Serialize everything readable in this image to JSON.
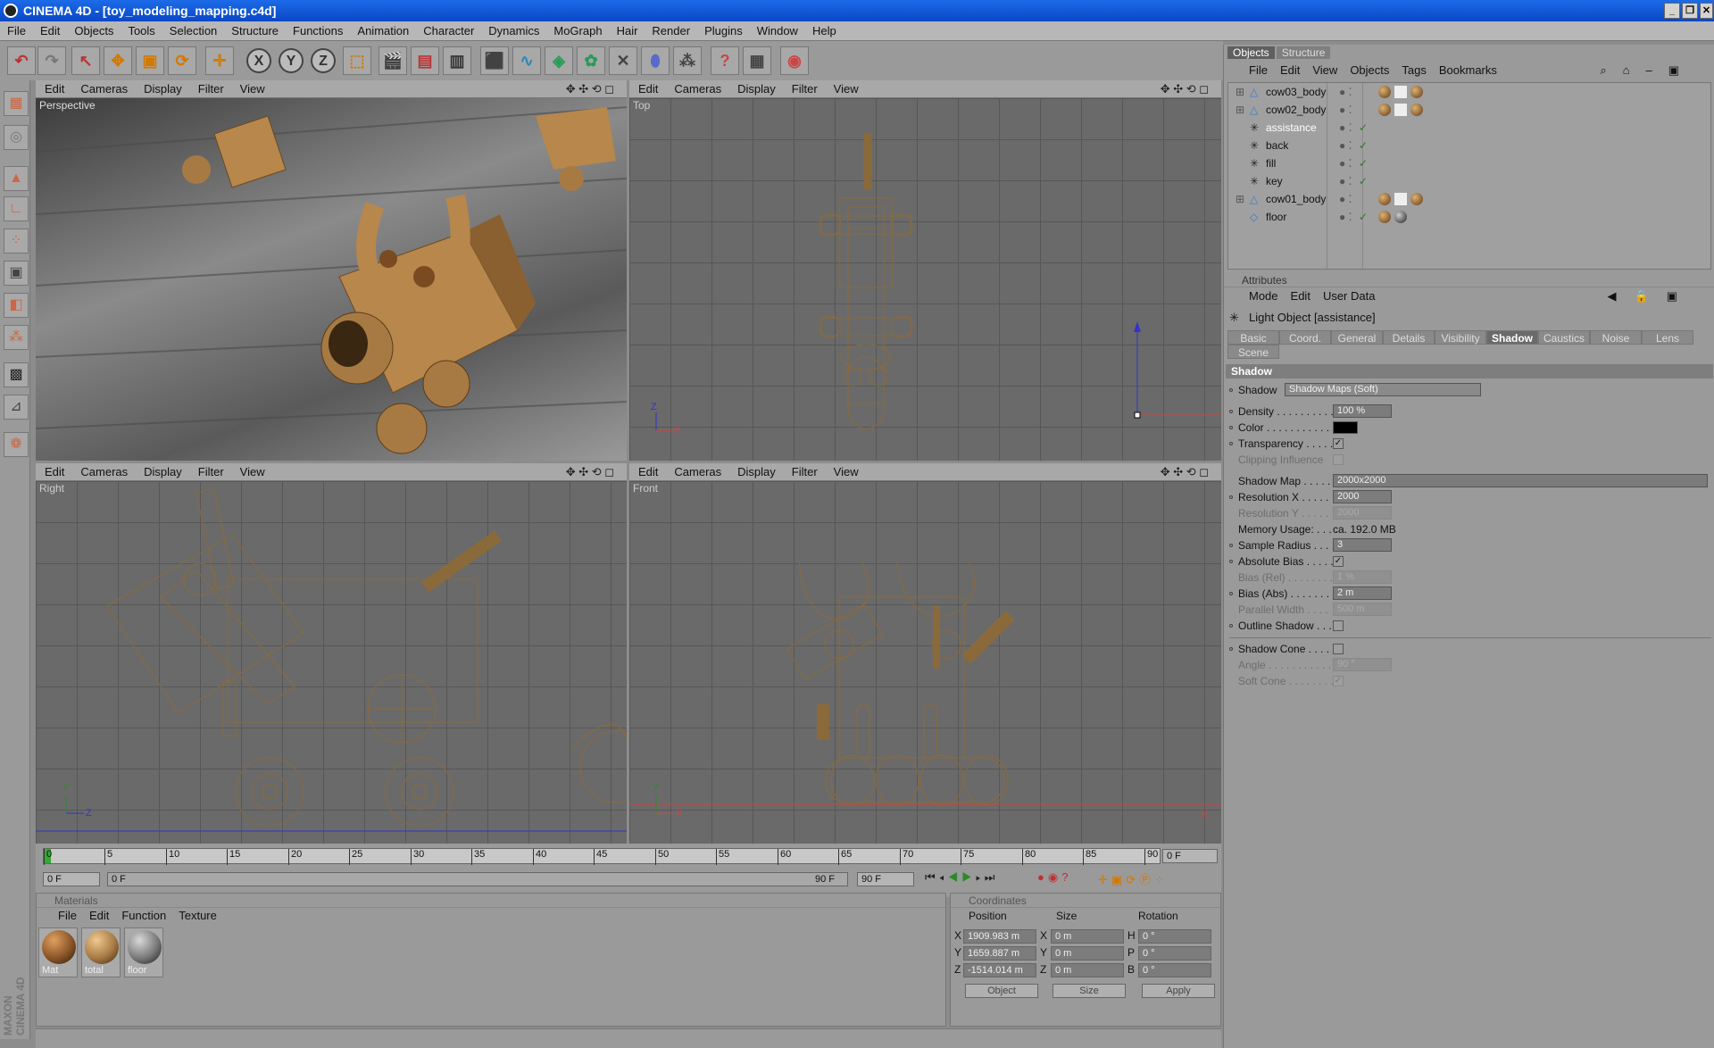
{
  "window": {
    "title": "CINEMA 4D - [toy_modeling_mapping.c4d]"
  },
  "menubar": [
    "File",
    "Edit",
    "Objects",
    "Tools",
    "Selection",
    "Structure",
    "Functions",
    "Animation",
    "Character",
    "Dynamics",
    "MoGraph",
    "Hair",
    "Render",
    "Plugins",
    "Window",
    "Help"
  ],
  "toolbar_icons": [
    "undo-icon",
    "redo-icon",
    "select-icon",
    "move-icon",
    "scale-icon",
    "rotate-icon",
    "live-select-icon",
    "x-axis-icon",
    "y-axis-icon",
    "z-axis-icon",
    "coordinate-system-icon",
    "render-view-icon",
    "render-picture-viewer-icon",
    "edit-render-settings-icon",
    "cube-icon",
    "spline-icon",
    "nurbs-icon",
    "array-icon",
    "deformer-icon",
    "scene-icon",
    "camera-icon",
    "light-icon",
    "help-icon",
    "texture-icon",
    "web-icon"
  ],
  "toolbar_glyphs": {
    "x": "X",
    "y": "Y",
    "z": "Z"
  },
  "viewport_menu": [
    "Edit",
    "Cameras",
    "Display",
    "Filter",
    "View"
  ],
  "viewport_nav_glyphs": "✥ ✣ ⟲ ◻",
  "viewports": {
    "perspective": "Perspective",
    "top": "Top",
    "right": "Right",
    "front": "Front"
  },
  "axis_labels": {
    "x": "X",
    "y": "Y",
    "z": "Z"
  },
  "timeline": {
    "ticks": [
      "0",
      "5",
      "10",
      "15",
      "20",
      "25",
      "30",
      "35",
      "40",
      "45",
      "50",
      "55",
      "60",
      "65",
      "70",
      "75",
      "80",
      "85",
      "90"
    ],
    "current_frame": "0 F",
    "start_frame": "0 F",
    "min_field": "0 F",
    "max_field": "90 F",
    "end_frame": "90 F"
  },
  "materials": {
    "title": "Materials",
    "menu": [
      "File",
      "Edit",
      "Function",
      "Texture"
    ],
    "items": [
      {
        "name": "Mat",
        "color": "#8a5528"
      },
      {
        "name": "total",
        "color": "#a77a44"
      },
      {
        "name": "floor",
        "color": "#7a7a7a"
      }
    ]
  },
  "coordinates": {
    "title": "Coordinates",
    "headers": [
      "Position",
      "Size",
      "Rotation"
    ],
    "rows": [
      {
        "axis": "X",
        "pos": "1909.983 m",
        "size_axis": "X",
        "size": "0 m",
        "rot_axis": "H",
        "rot": "0 °"
      },
      {
        "axis": "Y",
        "pos": "1659.887 m",
        "size_axis": "Y",
        "size": "0 m",
        "rot_axis": "P",
        "rot": "0 °"
      },
      {
        "axis": "Z",
        "pos": "-1514.014 m",
        "size_axis": "Z",
        "size": "0 m",
        "rot_axis": "B",
        "rot": "0 °"
      }
    ],
    "mode_select": "Object",
    "size_select": "Size",
    "apply": "Apply"
  },
  "objects_panel": {
    "tabs": [
      "Objects",
      "Structure"
    ],
    "menu": [
      "File",
      "Edit",
      "View",
      "Objects",
      "Tags",
      "Bookmarks"
    ],
    "items": [
      {
        "name": "cow03_body",
        "tags": true,
        "checked": false
      },
      {
        "name": "cow02_body",
        "tags": true,
        "checked": false
      },
      {
        "name": "assistance",
        "tags": false,
        "checked": true,
        "selected": true
      },
      {
        "name": "back",
        "tags": false,
        "checked": true
      },
      {
        "name": "fill",
        "tags": false,
        "checked": true
      },
      {
        "name": "key",
        "tags": false,
        "checked": true
      },
      {
        "name": "cow01_body",
        "tags": true,
        "checked": false
      },
      {
        "name": "floor",
        "tags": true,
        "checked": true
      }
    ]
  },
  "attributes": {
    "title": "Attributes",
    "menu": [
      "Mode",
      "Edit",
      "User Data"
    ],
    "object_title": "Light Object [assistance]",
    "tabs": [
      "Basic",
      "Coord.",
      "General",
      "Details",
      "Visibility",
      "Shadow",
      "Caustics",
      "Noise",
      "Lens",
      "Scene"
    ],
    "active_tab": "Shadow",
    "section": "Shadow",
    "shadow_type": "Shadow Maps (Soft)",
    "props": {
      "shadow_label": "Shadow",
      "density_label": "Density . . . . . . . . . .",
      "density": "100 %",
      "color_label": "Color . . . . . . . . . . . .",
      "transparency_label": "Transparency . . . . .",
      "clipping_label": "Clipping Influence",
      "shadow_map_label": "Shadow Map . . . . .",
      "shadow_map": "2000x2000",
      "resx_label": "Resolution X . . . . .",
      "resx": "2000",
      "resy_label": "Resolution Y . . . . .",
      "resy": "2000",
      "memory_label": "Memory Usage: . . . .",
      "memory": "ca. 192.0 MB",
      "sample_label": "Sample Radius . . . .",
      "sample": "3",
      "absbias_label": "Absolute Bias . . . . .",
      "biasrel_label": "Bias (Rel) . . . . . . . .",
      "biasrel": "1 %",
      "biasabs_label": "Bias (Abs) . . . . . . .",
      "biasabs": "2 m",
      "parallel_label": "Parallel Width . . . .",
      "parallel": "500 m",
      "outline_label": "Outline Shadow . . .",
      "cone_label": "Shadow Cone . . . .",
      "angle_label": "Angle . . . . . . . . . . .",
      "angle": "90 °",
      "softcone_label": "Soft Cone . . . . . . . ."
    }
  },
  "brand": "MAXON CINEMA 4D"
}
